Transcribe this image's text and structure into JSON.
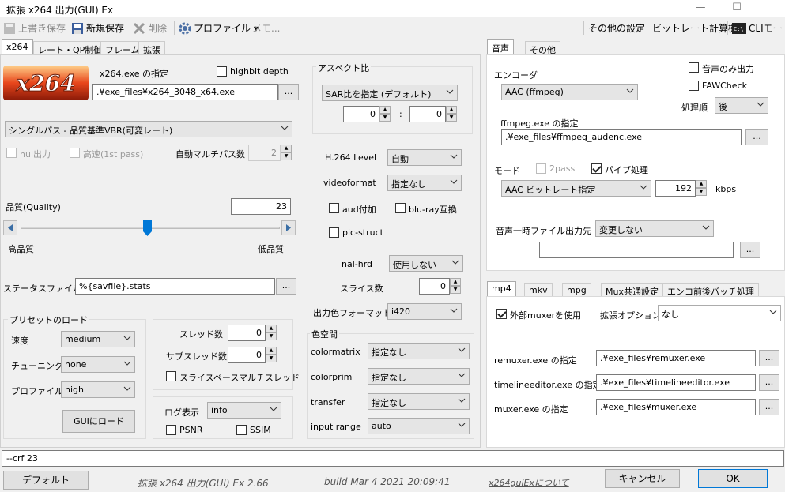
{
  "window": {
    "title": "拡張 x264 出力(GUI) Ex",
    "minimize": "—",
    "maximize": "☐"
  },
  "toolbar": {
    "overwrite_save": "上書き保存",
    "new_save": "新規保存",
    "delete": "削除",
    "profile": "プロファイル ▾",
    "memo": "メモ...",
    "other_settings": "その他の設定",
    "bitrate_calc": "ビットレート計算機",
    "cli_mode": "CLIモード"
  },
  "tabs_main": [
    "x264",
    "レート・QP制御",
    "フレーム",
    "拡張"
  ],
  "x264": {
    "logo": "x264",
    "exe_label": "x264.exe の指定",
    "highbit_label": "highbit depth",
    "exe_path": ".¥exe_files¥x264_3048_x64.exe",
    "dots": "...",
    "mode": "シングルパス - 品質基準VBR(可変レート)",
    "nul_label": "nul出力",
    "fast_label": "高速(1st pass)",
    "auto_multipass_label": "自動マルチパス数",
    "auto_multipass_value": "2",
    "quality_label": "品質(Quality)",
    "quality_value": "23",
    "high_quality": "高品質",
    "low_quality": "低品質",
    "status_file_label": "ステータスファイル",
    "status_file_value": "%{savfile}.stats"
  },
  "preset": {
    "group": "プリセットのロード",
    "speed_label": "速度",
    "speed_value": "medium",
    "tuning_label": "チューニング",
    "tuning_value": "none",
    "profile_label": "プロファイル",
    "profile_value": "high",
    "load_button": "GUIにロード"
  },
  "thread": {
    "threads_label": "スレッド数",
    "threads_value": "0",
    "subthreads_label": "サブスレッド数",
    "subthreads_value": "0",
    "slice_multi_label": "スライスベースマルチスレッド"
  },
  "log": {
    "label": "ログ表示",
    "value": "info",
    "psnr": "PSNR",
    "ssim": "SSIM"
  },
  "aspect": {
    "group": "アスペクト比",
    "mode": "SAR比を指定 (デフォルト)",
    "w": "0",
    "h": "0",
    "colon": ":"
  },
  "h264": {
    "level_label": "H.264 Level",
    "level_value": "自動",
    "videoformat_label": "videoformat",
    "videoformat_value": "指定なし",
    "aud_label": "aud付加",
    "bluray_label": "blu-ray互換",
    "picstruct_label": "pic-struct",
    "nalhrd_label": "nal-hrd",
    "nalhrd_value": "使用しない",
    "slices_label": "スライス数",
    "slices_value": "0",
    "outcolor_label": "出力色フォーマット",
    "outcolor_value": "i420"
  },
  "colorspace": {
    "group": "色空間",
    "matrix_label": "colormatrix",
    "matrix_value": "指定なし",
    "prim_label": "colorprim",
    "prim_value": "指定なし",
    "transfer_label": "transfer",
    "transfer_value": "指定なし",
    "range_label": "input range",
    "range_value": "auto"
  },
  "tabs_audio": [
    "音声",
    "その他"
  ],
  "audio": {
    "encoder_label": "エンコーダ",
    "encoder_value": "AAC (ffmpeg)",
    "audio_only_label": "音声のみ出力",
    "faw_label": "FAWCheck",
    "order_label": "処理順",
    "order_value": "後",
    "ffmpeg_label": "ffmpeg.exe の指定",
    "ffmpeg_path": ".¥exe_files¥ffmpeg_audenc.exe",
    "mode_label": "モード",
    "twopass_label": "2pass",
    "pipe_label": "パイプ処理",
    "bitrate_mode": "AAC ビットレート指定",
    "bitrate_value": "192",
    "kbps": "kbps",
    "temp_label": "音声一時ファイル出力先",
    "temp_value": "変更しない"
  },
  "tabs_mux": [
    "mp4",
    "mkv",
    "mpg",
    "Mux共通設定",
    "エンコ前後バッチ処理"
  ],
  "mux": {
    "external_label": "外部muxerを使用",
    "ext_option_label": "拡張オプション",
    "ext_option_value": "なし",
    "remuxer_label": "remuxer.exe の指定",
    "remuxer_path": ".¥exe_files¥remuxer.exe",
    "timeline_label": "timelineeditor.exe の指定",
    "timeline_path": ".¥exe_files¥timelineeditor.exe",
    "muxer_label": "muxer.exe の指定",
    "muxer_path": ".¥exe_files¥muxer.exe"
  },
  "status": {
    "cmdline": "--crf 23"
  },
  "footer": {
    "default_button": "デフォルト",
    "app_name": "拡張 x264 出力(GUI) Ex 2.66",
    "build": "build Mar  4 2021 20:09:41",
    "about_link": "x264guiExについて",
    "cancel_button": "キャンセル",
    "ok_button": "OK"
  },
  "slider": {
    "value_fraction": 0.49
  }
}
